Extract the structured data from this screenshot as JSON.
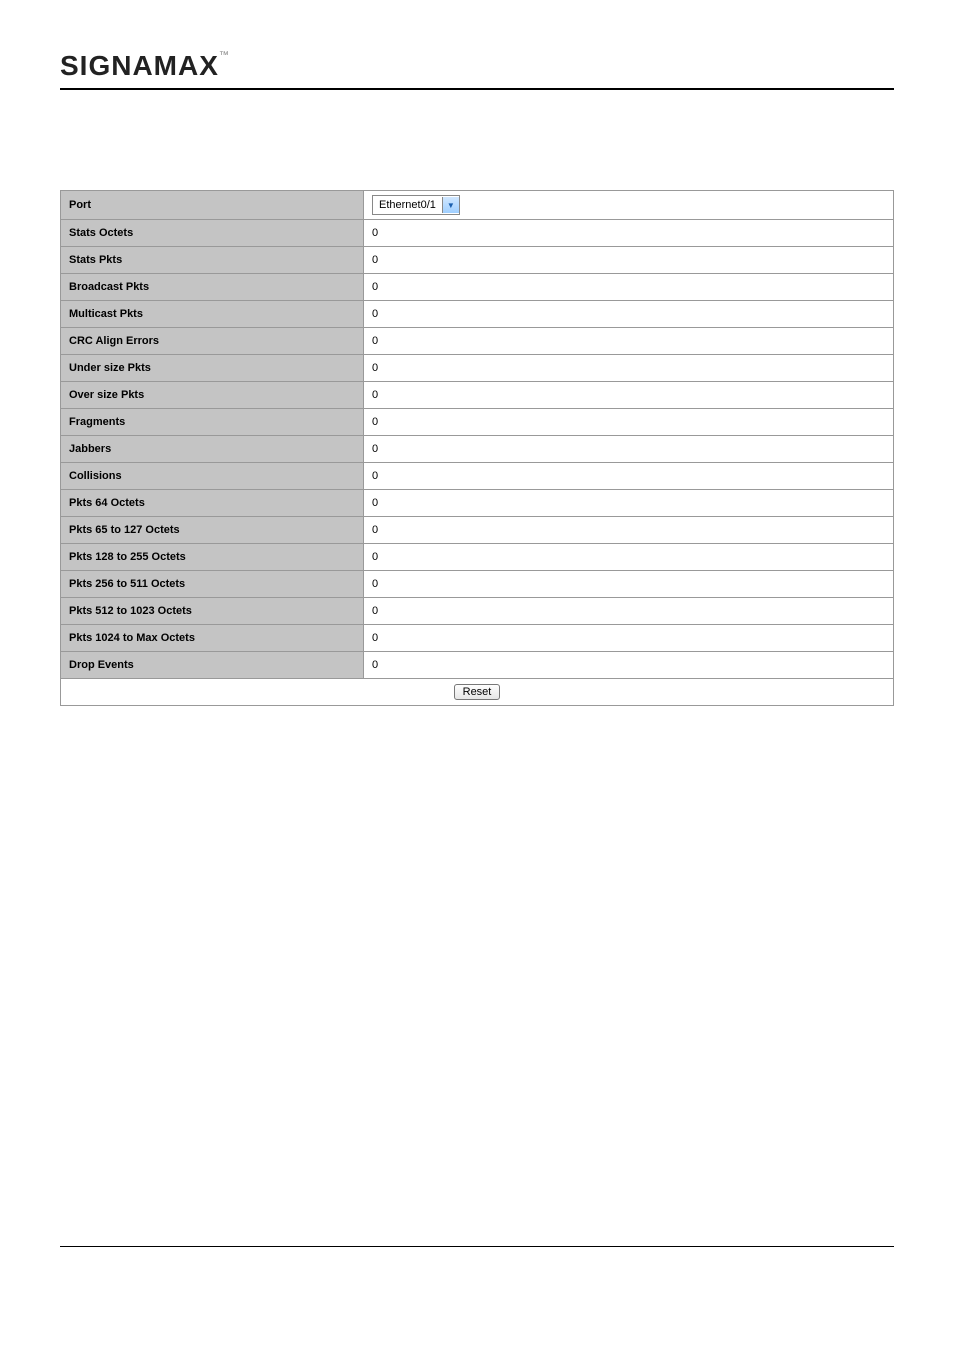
{
  "brand": "SIGNAMAX",
  "port_label": "Port",
  "port_value": "Ethernet0/1",
  "rows": [
    {
      "label": "Stats Octets",
      "value": "0"
    },
    {
      "label": "Stats Pkts",
      "value": "0"
    },
    {
      "label": "Broadcast Pkts",
      "value": "0"
    },
    {
      "label": "Multicast Pkts",
      "value": "0"
    },
    {
      "label": "CRC Align Errors",
      "value": "0"
    },
    {
      "label": "Under size Pkts",
      "value": "0"
    },
    {
      "label": "Over size Pkts",
      "value": "0"
    },
    {
      "label": "Fragments",
      "value": "0"
    },
    {
      "label": "Jabbers",
      "value": "0"
    },
    {
      "label": "Collisions",
      "value": "0"
    },
    {
      "label": "Pkts 64 Octets",
      "value": "0"
    },
    {
      "label": "Pkts 65 to 127 Octets",
      "value": "0"
    },
    {
      "label": "Pkts 128 to 255 Octets",
      "value": "0"
    },
    {
      "label": "Pkts 256 to 511 Octets",
      "value": "0"
    },
    {
      "label": "Pkts 512 to 1023 Octets",
      "value": "0"
    },
    {
      "label": "Pkts 1024 to Max Octets",
      "value": "0"
    },
    {
      "label": "Drop Events",
      "value": "0"
    }
  ],
  "reset_label": "Reset"
}
